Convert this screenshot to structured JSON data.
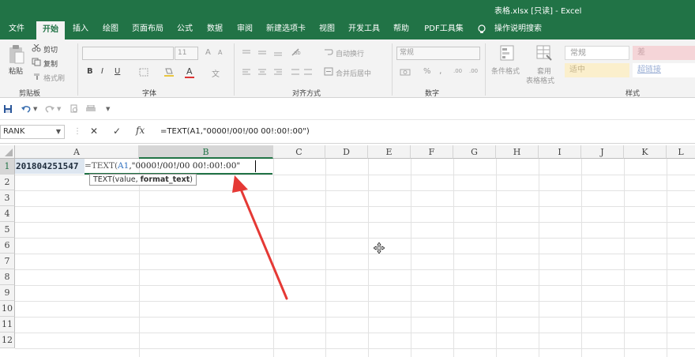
{
  "window": {
    "title": "表格.xlsx  [只读]  -  Excel"
  },
  "tabs": [
    {
      "label": "文件"
    },
    {
      "label": "开始",
      "active": true
    },
    {
      "label": "插入"
    },
    {
      "label": "绘图"
    },
    {
      "label": "页面布局"
    },
    {
      "label": "公式"
    },
    {
      "label": "数据"
    },
    {
      "label": "审阅"
    },
    {
      "label": "新建选项卡"
    },
    {
      "label": "视图"
    },
    {
      "label": "开发工具"
    },
    {
      "label": "帮助"
    },
    {
      "label": "PDF工具集"
    }
  ],
  "tell_me": {
    "label": "操作说明搜索",
    "icon": "lightbulb-icon"
  },
  "ribbon": {
    "clipboard": {
      "group": "剪贴板",
      "paste": "粘贴",
      "cut": "剪切",
      "copy": "复制",
      "format_painter": "格式刷"
    },
    "font": {
      "group": "字体",
      "font_size": "11",
      "bold": "B",
      "italic": "I",
      "underline": "U",
      "grow": "A",
      "shrink": "A",
      "font_color": "A",
      "phonetic": "文"
    },
    "alignment": {
      "group": "对齐方式",
      "wrap_text": "自动换行",
      "merge_center": "合并后居中"
    },
    "number": {
      "group": "数字",
      "format": "常规",
      "percent": "%",
      "comma": ",",
      "inc_decimal": ".00",
      "dec_decimal": ".00"
    },
    "styles": {
      "group": "样式",
      "conditional": "条件格式",
      "table_format_1": "套用",
      "table_format_2": "表格格式",
      "cells": [
        {
          "label": "常规",
          "bg": "#ffffff",
          "color": "#9a9a9a"
        },
        {
          "label": "差",
          "bg": "#f5d5d8",
          "color": "#c9a5a9"
        },
        {
          "label": "适中",
          "bg": "#fbefcc",
          "color": "#c4b48c"
        },
        {
          "label": "超链接",
          "bg": "#ffffff",
          "color": "#9aaed4"
        }
      ]
    }
  },
  "formula_bar": {
    "name_box": "RANK",
    "cancel": "✕",
    "enter": "✓",
    "fx": "fx",
    "formula": "=TEXT(A1,\"0000!/00!/00 00!:00!:00\")"
  },
  "grid": {
    "columns": [
      "A",
      "B",
      "C",
      "D",
      "E",
      "F",
      "G",
      "H",
      "I",
      "J",
      "K",
      "L"
    ],
    "rows": [
      "1",
      "2",
      "3",
      "4",
      "5",
      "6",
      "7",
      "8",
      "9",
      "10",
      "11",
      "12"
    ],
    "a1": "201804251547",
    "b1_fn": "=TEXT(",
    "b1_ref": "A1",
    "b1_rest": ",\"0000!/00!/00 00!:00!:00\"",
    "tooltip_func": "TEXT(value, ",
    "tooltip_arg": "format_text",
    "tooltip_close": ")"
  },
  "colors": {
    "accent": "#217346",
    "arrow": "#e53935"
  }
}
